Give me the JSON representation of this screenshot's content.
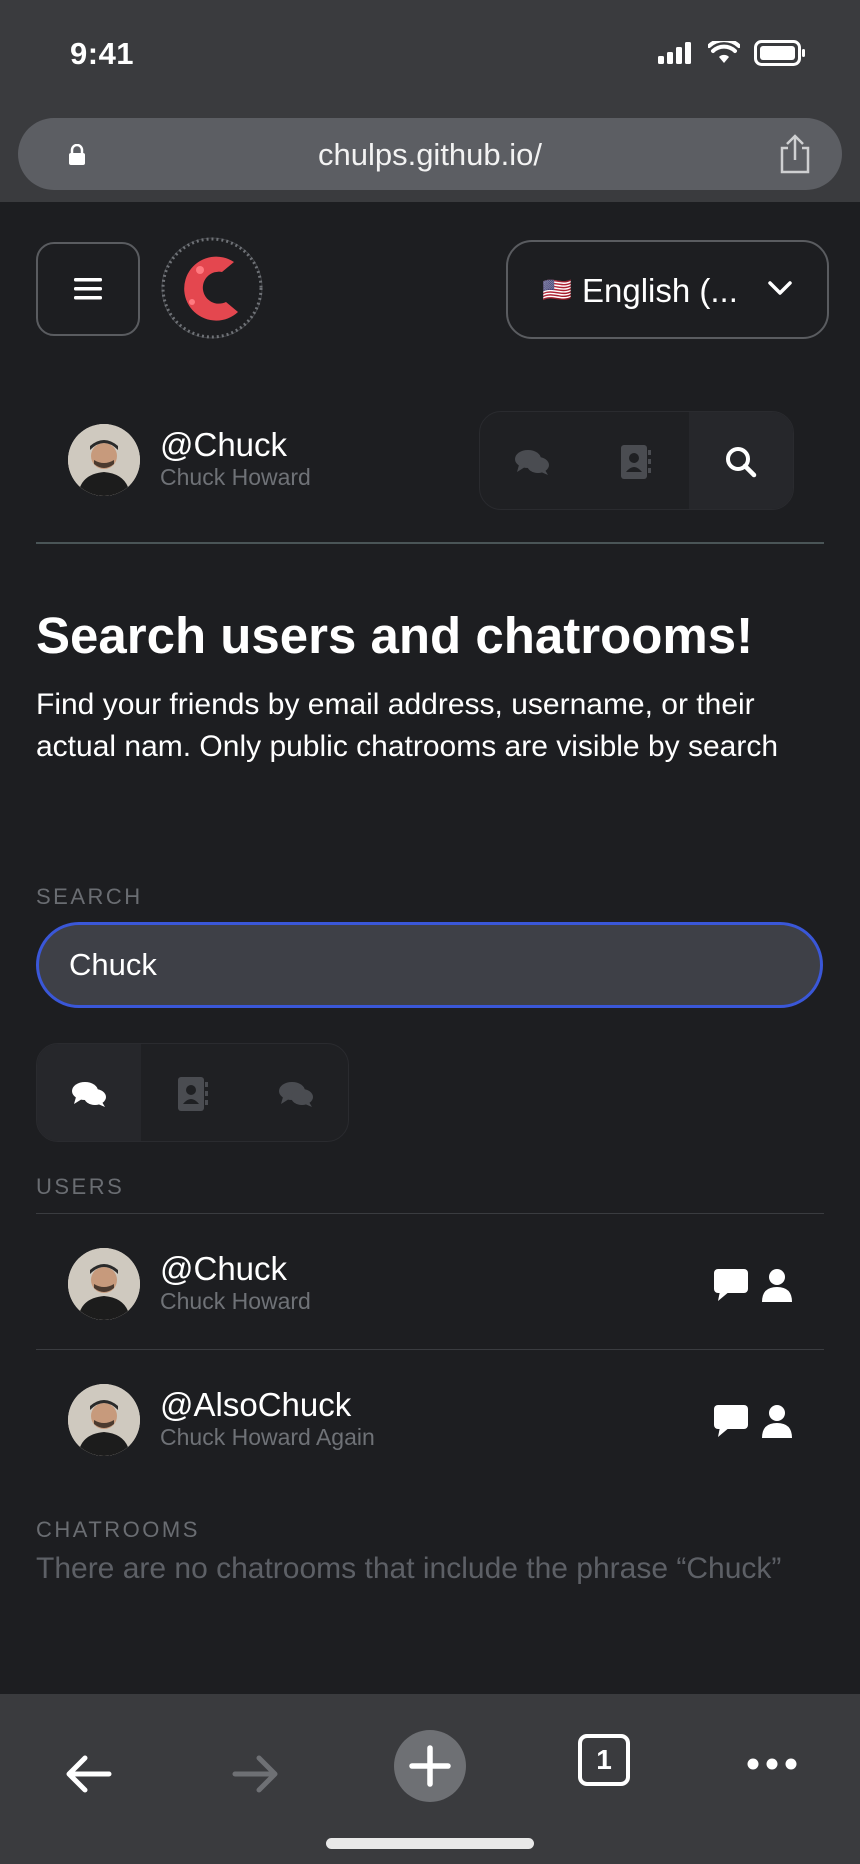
{
  "status_bar": {
    "time": "9:41"
  },
  "browser": {
    "url": "chulps.github.io/"
  },
  "header": {
    "language_flag": "🇺🇸",
    "language_label": "English (..."
  },
  "profile": {
    "username": "@Chuck",
    "name": "Chuck Howard"
  },
  "main": {
    "title": "Search users and chatrooms!",
    "description": "Find your friends by email address, username, or their actual nam. Only public chatrooms are visible by search",
    "search_label": "SEARCH",
    "search_value": "Chuck",
    "users_label": "USERS",
    "users": [
      {
        "username": "@Chuck",
        "name": "Chuck Howard"
      },
      {
        "username": "@AlsoChuck",
        "name": "Chuck Howard Again"
      }
    ],
    "chatrooms_label": "CHATROOMS",
    "chatrooms_empty": "There are no chatrooms that include the phrase “Chuck”"
  },
  "bottom_bar": {
    "tab_count": "1"
  },
  "colors": {
    "background": "#1d1e21",
    "browser_chrome": "#3a3b3e",
    "accent_focus": "#3a57d8",
    "muted_text": "#6f7277"
  }
}
